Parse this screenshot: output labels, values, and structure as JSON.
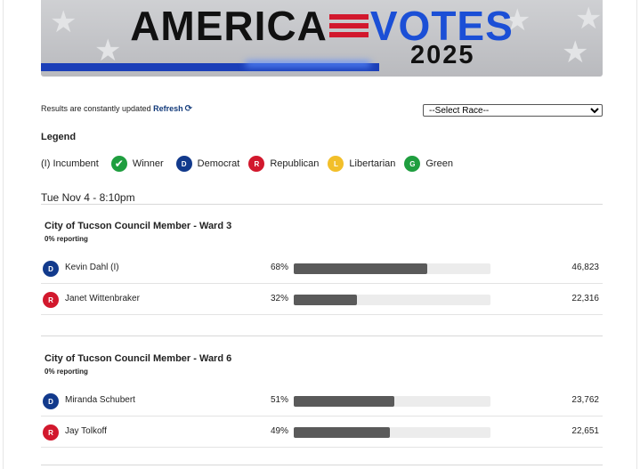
{
  "banner": {
    "word1": "AMERICA",
    "word2": "VOTES",
    "year": "2025"
  },
  "toolbar": {
    "updated_text": "Results are constantly updated",
    "refresh_label": "Refresh",
    "refresh_icon": "refresh-icon",
    "race_select_value": "--Select Race--"
  },
  "legend": {
    "title": "Legend",
    "items": [
      {
        "badge": "",
        "label": "(I) Incumbent"
      },
      {
        "badge": "✔",
        "label": "Winner",
        "color": "#1f9e3f"
      },
      {
        "badge": "D",
        "label": "Democrat",
        "color": "#123a8c"
      },
      {
        "badge": "R",
        "label": "Republican",
        "color": "#d2182d"
      },
      {
        "badge": "L",
        "label": "Libertarian",
        "color": "#f2bf2a"
      },
      {
        "badge": "G",
        "label": "Green",
        "color": "#1f9e3f"
      }
    ]
  },
  "timestamp": "Tue Nov 4 - 8:10pm",
  "races": [
    {
      "title": "City of Tucson Council Member - Ward 3",
      "reporting": "0% reporting",
      "candidates": [
        {
          "party": "D",
          "name": "Kevin Dahl (I)",
          "pct_label": "68%",
          "pct": 68,
          "votes": "46,823"
        },
        {
          "party": "R",
          "name": "Janet Wittenbraker",
          "pct_label": "32%",
          "pct": 32,
          "votes": "22,316"
        }
      ]
    },
    {
      "title": "City of Tucson Council Member - Ward 6",
      "reporting": "0% reporting",
      "candidates": [
        {
          "party": "D",
          "name": "Miranda Schubert",
          "pct_label": "51%",
          "pct": 51,
          "votes": "23,762"
        },
        {
          "party": "R",
          "name": "Jay Tolkoff",
          "pct_label": "49%",
          "pct": 49,
          "votes": "22,651"
        }
      ]
    }
  ]
}
